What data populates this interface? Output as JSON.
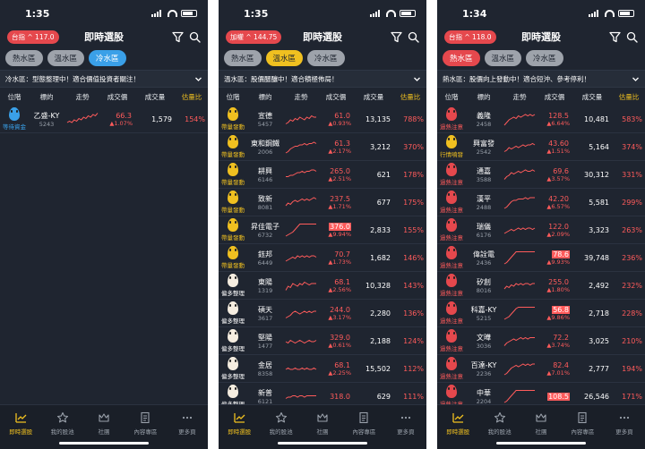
{
  "colors": {
    "up": "#ff5b5b",
    "cold": "#3aa0e8",
    "warm": "#f0c020",
    "hot": "#e5484d",
    "bg": "#1f2530"
  },
  "columns": {
    "pos": "位階",
    "name": "標的",
    "trend": "走勢",
    "price": "成交價",
    "vol": "成交量",
    "ratio": "估量比"
  },
  "nav": [
    {
      "label": "即時選股",
      "icon": "chart-up-icon"
    },
    {
      "label": "我的股池",
      "icon": "star-icon"
    },
    {
      "label": "社團",
      "icon": "crown-icon"
    },
    {
      "label": "內容專區",
      "icon": "document-icon"
    },
    {
      "label": "更多頁",
      "icon": "more-dots-icon"
    }
  ],
  "screens": [
    {
      "time": "1:35",
      "index_label": "台指 ^ 117.0",
      "title": "即時選股",
      "tabs": [
        "熱水區",
        "溫水區",
        "冷水區"
      ],
      "active_tab": 2,
      "notice": "冷水區：型態整理中！適合價值投資者關注！",
      "rows": [
        {
          "drop": "#3aa0e8",
          "label": "等待資金",
          "label_color": "#3aa0e8",
          "name": "乙盛-KY",
          "code": "5243",
          "price": "66.3",
          "chg": "▲1.07%",
          "vol": "1,579",
          "ratio": "154%",
          "hl": false,
          "trend": [
            4,
            5,
            4,
            6,
            5,
            7,
            6,
            8,
            7,
            9,
            8,
            10,
            9,
            11
          ]
        }
      ]
    },
    {
      "time": "1:35",
      "index_label": "加權 ^ 144.75",
      "title": "即時選股",
      "tabs": [
        "熱水區",
        "溫水區",
        "冷水區"
      ],
      "active_tab": 1,
      "notice": "溫水區：股價醞釀中！適合積極佈局！",
      "rows": [
        {
          "drop": "#f0c020",
          "label": "帶量發動",
          "label_color": "#f0c020",
          "name": "宣德",
          "code": "5457",
          "price": "61.0",
          "chg": "▲0.93%",
          "vol": "13,135",
          "ratio": "788%",
          "hl": false,
          "trend": [
            3,
            4,
            6,
            5,
            7,
            6,
            8,
            7,
            6,
            8,
            7,
            9,
            8,
            8
          ]
        },
        {
          "drop": "#f0c020",
          "label": "帶量發動",
          "label_color": "#f0c020",
          "name": "東和鋼鐵",
          "code": "2006",
          "price": "61.3",
          "chg": "▲2.17%",
          "vol": "3,212",
          "ratio": "370%",
          "hl": false,
          "trend": [
            2,
            3,
            5,
            6,
            7,
            7,
            8,
            8,
            9,
            8,
            9,
            9,
            10,
            9
          ]
        },
        {
          "drop": "#f0c020",
          "label": "帶量發動",
          "label_color": "#f0c020",
          "name": "耕興",
          "code": "6146",
          "price": "265.0",
          "chg": "▲2.51%",
          "vol": "621",
          "ratio": "178%",
          "hl": false,
          "trend": [
            5,
            5,
            6,
            6,
            7,
            8,
            8,
            9,
            8,
            9,
            9,
            10,
            10,
            9
          ]
        },
        {
          "drop": "#f0c020",
          "label": "帶量發動",
          "label_color": "#f0c020",
          "name": "致新",
          "code": "8081",
          "price": "237.5",
          "chg": "▲1.71%",
          "vol": "677",
          "ratio": "175%",
          "hl": false,
          "trend": [
            4,
            6,
            5,
            7,
            8,
            7,
            8,
            9,
            8,
            9,
            8,
            9,
            10,
            9
          ]
        },
        {
          "drop": "#f0c020",
          "label": "帶量發動",
          "label_color": "#f0c020",
          "name": "昇佳電子",
          "code": "6732",
          "price": "376.0",
          "chg": "▲9.94%",
          "vol": "2,833",
          "ratio": "155%",
          "hl": true,
          "trend": [
            2,
            3,
            4,
            5,
            7,
            9,
            11,
            11,
            11,
            11,
            11,
            11,
            11,
            11
          ]
        },
        {
          "drop": "#f0c020",
          "label": "帶量發動",
          "label_color": "#f0c020",
          "name": "鈺邦",
          "code": "6449",
          "price": "70.7",
          "chg": "▲1.73%",
          "vol": "1,682",
          "ratio": "146%",
          "hl": false,
          "trend": [
            4,
            5,
            6,
            7,
            6,
            8,
            7,
            8,
            7,
            8,
            7,
            8,
            8,
            7
          ]
        },
        {
          "drop": "#f5ede0",
          "label": "偏多整理",
          "label_color": "#ffffff",
          "name": "東陽",
          "code": "1319",
          "price": "68.1",
          "chg": "▲2.56%",
          "vol": "10,328",
          "ratio": "143%",
          "hl": false,
          "trend": [
            3,
            6,
            5,
            8,
            7,
            6,
            8,
            7,
            9,
            8,
            7,
            8,
            8,
            8
          ]
        },
        {
          "drop": "#f5ede0",
          "label": "偏多整理",
          "label_color": "#ffffff",
          "name": "碩天",
          "code": "3617",
          "price": "244.0",
          "chg": "▲3.17%",
          "vol": "2,280",
          "ratio": "136%",
          "hl": false,
          "trend": [
            3,
            4,
            5,
            7,
            8,
            7,
            6,
            7,
            8,
            7,
            8,
            7,
            8,
            8
          ]
        },
        {
          "drop": "#f5ede0",
          "label": "偏多整理",
          "label_color": "#ffffff",
          "name": "堅陽",
          "code": "1477",
          "price": "329.0",
          "chg": "▲0.61%",
          "vol": "2,188",
          "ratio": "124%",
          "hl": false,
          "trend": [
            6,
            5,
            7,
            6,
            5,
            6,
            7,
            6,
            5,
            6,
            7,
            6,
            6,
            7
          ]
        },
        {
          "drop": "#f5ede0",
          "label": "偏多整理",
          "label_color": "#ffffff",
          "name": "金居",
          "code": "8358",
          "price": "68.1",
          "chg": "▲2.25%",
          "vol": "15,502",
          "ratio": "112%",
          "hl": false,
          "trend": [
            6,
            7,
            6,
            6,
            7,
            6,
            6,
            7,
            6,
            7,
            6,
            6,
            7,
            6
          ]
        },
        {
          "drop": "#f5ede0",
          "label": "偏多整理",
          "label_color": "#ffffff",
          "name": "新普",
          "code": "6121",
          "price": "318.0",
          "chg": "",
          "vol": "629",
          "ratio": "111%",
          "hl": false,
          "trend": [
            5,
            6,
            6,
            7,
            7,
            6,
            7,
            7,
            6,
            7,
            7,
            7,
            7,
            7
          ]
        }
      ]
    },
    {
      "time": "1:34",
      "index_label": "台指 ^ 118.0",
      "title": "即時選股",
      "tabs": [
        "熱水區",
        "溫水區",
        "冷水區"
      ],
      "active_tab": 0,
      "notice": "熱水區：股價向上發動中！適合短沖、參考停利！",
      "rows": [
        {
          "drop": "#e5484d",
          "label": "過熱注意",
          "label_color": "#ff5b5b",
          "name": "義隆",
          "code": "2458",
          "price": "128.5",
          "chg": "▲6.64%",
          "vol": "10,481",
          "ratio": "583%",
          "hl": false,
          "trend": [
            2,
            4,
            6,
            7,
            8,
            7,
            9,
            8,
            9,
            10,
            9,
            10,
            9,
            10
          ]
        },
        {
          "drop": "#f0c020",
          "label": "行情噴發",
          "label_color": "#f0c020",
          "name": "興富發",
          "code": "2542",
          "price": "43.60",
          "chg": "▲1.51%",
          "vol": "5,164",
          "ratio": "374%",
          "hl": false,
          "trend": [
            3,
            4,
            6,
            5,
            6,
            7,
            6,
            7,
            8,
            7,
            8,
            8,
            9,
            8
          ]
        },
        {
          "drop": "#e5484d",
          "label": "過熱注意",
          "label_color": "#ff5b5b",
          "name": "通嘉",
          "code": "3588",
          "price": "69.6",
          "chg": "▲3.57%",
          "vol": "30,312",
          "ratio": "331%",
          "hl": false,
          "trend": [
            3,
            5,
            6,
            8,
            7,
            8,
            9,
            8,
            9,
            10,
            9,
            9,
            10,
            9
          ]
        },
        {
          "drop": "#e5484d",
          "label": "過熱注意",
          "label_color": "#ff5b5b",
          "name": "漢平",
          "code": "2488",
          "price": "42.20",
          "chg": "▲6.57%",
          "vol": "5,581",
          "ratio": "299%",
          "hl": false,
          "trend": [
            2,
            3,
            5,
            7,
            8,
            8,
            9,
            9,
            9,
            10,
            9,
            10,
            10,
            10
          ]
        },
        {
          "drop": "#e5484d",
          "label": "過熱注意",
          "label_color": "#ff5b5b",
          "name": "瑞儀",
          "code": "6176",
          "price": "122.0",
          "chg": "▲2.09%",
          "vol": "3,323",
          "ratio": "263%",
          "hl": false,
          "trend": [
            4,
            5,
            6,
            7,
            6,
            7,
            8,
            7,
            8,
            7,
            8,
            8,
            7,
            8
          ]
        },
        {
          "drop": "#e5484d",
          "label": "過熱注意",
          "label_color": "#ff5b5b",
          "name": "偉詮電",
          "code": "2436",
          "price": "78.6",
          "chg": "▲9.93%",
          "vol": "39,748",
          "ratio": "236%",
          "hl": true,
          "trend": [
            2,
            3,
            5,
            7,
            9,
            11,
            11,
            11,
            11,
            11,
            11,
            11,
            11,
            11
          ]
        },
        {
          "drop": "#e5484d",
          "label": "過熱注意",
          "label_color": "#ff5b5b",
          "name": "矽創",
          "code": "8016",
          "price": "255.0",
          "chg": "▲1.80%",
          "vol": "2,492",
          "ratio": "232%",
          "hl": false,
          "trend": [
            4,
            6,
            5,
            7,
            6,
            8,
            7,
            8,
            7,
            8,
            8,
            7,
            8,
            8
          ]
        },
        {
          "drop": "#e5484d",
          "label": "過熱注意",
          "label_color": "#ff5b5b",
          "name": "科嘉-KY",
          "code": "5215",
          "price": "56.8",
          "chg": "▲9.86%",
          "vol": "2,718",
          "ratio": "228%",
          "hl": true,
          "trend": [
            2,
            3,
            4,
            6,
            8,
            10,
            11,
            11,
            11,
            11,
            11,
            11,
            11,
            11
          ]
        },
        {
          "drop": "#e5484d",
          "label": "過熱注意",
          "label_color": "#ff5b5b",
          "name": "文曄",
          "code": "3036",
          "price": "72.2",
          "chg": "▲3.74%",
          "vol": "3,025",
          "ratio": "210%",
          "hl": false,
          "trend": [
            3,
            5,
            6,
            7,
            8,
            7,
            8,
            9,
            8,
            9,
            8,
            9,
            9,
            9
          ]
        },
        {
          "drop": "#e5484d",
          "label": "過熱注意",
          "label_color": "#ff5b5b",
          "name": "百達-KY",
          "code": "2236",
          "price": "82.4",
          "chg": "▲7.01%",
          "vol": "2,777",
          "ratio": "194%",
          "hl": false,
          "trend": [
            2,
            3,
            5,
            7,
            8,
            9,
            8,
            9,
            10,
            9,
            10,
            9,
            10,
            10
          ]
        },
        {
          "drop": "#e5484d",
          "label": "過熱注意",
          "label_color": "#ff5b5b",
          "name": "中華",
          "code": "2204",
          "price": "108.5",
          "chg": "",
          "vol": "26,546",
          "ratio": "171%",
          "hl": true,
          "trend": [
            2,
            3,
            5,
            7,
            9,
            11,
            11,
            11,
            11,
            11,
            11,
            11,
            11,
            11
          ]
        }
      ]
    }
  ]
}
